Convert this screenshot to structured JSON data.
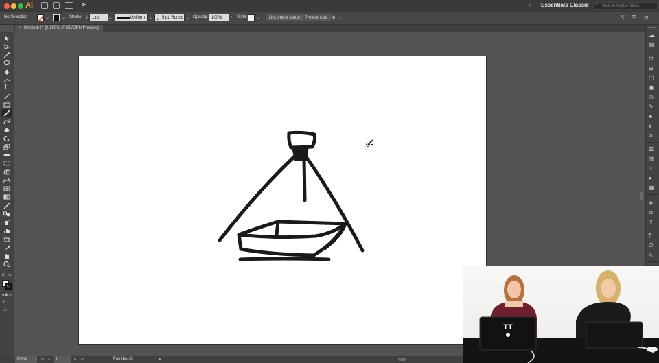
{
  "app": {
    "logo": "Ai",
    "workspace": "Essentials Classic",
    "search_placeholder": "Search Adobe Stock"
  },
  "colors": {
    "accent_logo": "#f29a32",
    "canvas": "#535353",
    "artboard": "#ffffff",
    "stroke": "#1a1a1a"
  },
  "control_bar": {
    "selection": "No Selection",
    "stroke_label": "Stroke:",
    "stroke_weight": "1 pt",
    "profile": "Uniform",
    "brush": "5 pt. Round",
    "opacity_label": "Opacity:",
    "opacity_value": "100%",
    "style_label": "Style:",
    "document_setup": "Document Setup",
    "preferences": "Preferences"
  },
  "document": {
    "tab_title": "Untitled-1* @ 200% (RGB/GPU Preview)",
    "close": "×"
  },
  "status_bar": {
    "zoom": "200%",
    "artboard_number": "1",
    "current_tool": "Paintbrush"
  },
  "video": {
    "laptop_sticker": "TT"
  },
  "icons": {
    "tools": [
      "selection-tool-icon",
      "direct-selection-tool-icon",
      "magic-wand-tool-icon",
      "lasso-tool-icon",
      "pen-tool-icon",
      "curvature-tool-icon",
      "type-tool-icon",
      "line-segment-tool-icon",
      "rectangle-tool-icon",
      "paintbrush-tool-icon",
      "shaper-tool-icon",
      "eraser-tool-icon",
      "rotate-tool-icon",
      "scale-tool-icon",
      "width-tool-icon",
      "free-transform-tool-icon",
      "shape-builder-tool-icon",
      "perspective-grid-tool-icon",
      "mesh-tool-icon",
      "gradient-tool-icon",
      "eyedropper-tool-icon",
      "blend-tool-icon",
      "symbol-sprayer-tool-icon",
      "column-graph-tool-icon",
      "artboard-tool-icon",
      "slice-tool-icon",
      "hand-tool-icon",
      "zoom-tool-icon"
    ],
    "panels": [
      "libraries-panel-icon",
      "properties-panel-icon",
      "transform-panel-icon",
      "align-panel-icon",
      "pathfinder-panel-icon",
      "appearance-panel-icon",
      "graphic-styles-panel-icon",
      "brushes-panel-icon",
      "symbols-panel-icon",
      "swatches-panel-icon",
      "links-panel-icon",
      "stroke-panel-icon",
      "gradient-panel-icon",
      "transparency-panel-icon",
      "color-panel-icon",
      "color-guide-panel-icon",
      "layers-panel-icon",
      "artboards-panel-icon",
      "asset-export-panel-icon",
      "paragraph-panel-icon",
      "opentype-panel-icon",
      "character-panel-icon",
      "glyphs-panel-icon",
      "actions-panel-icon",
      "play-icon"
    ]
  }
}
